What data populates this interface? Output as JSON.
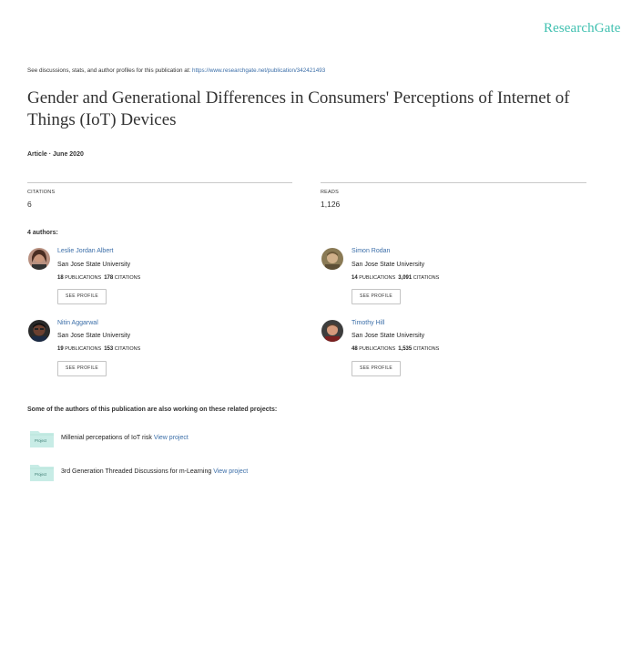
{
  "header": {
    "brand": "ResearchGate",
    "see_line_prefix": "See discussions, stats, and author profiles for this publication at:",
    "see_line_url": "https://www.researchgate.net/publication/342421493"
  },
  "publication": {
    "title": "Gender and Generational Differences in Consumers' Perceptions of Internet of Things (IoT) Devices",
    "meta": "Article · June 2020"
  },
  "stats": {
    "citations_label": "CITATIONS",
    "citations_value": "6",
    "reads_label": "READS",
    "reads_value": "1,126"
  },
  "authors_heading": "4 authors:",
  "authors": [
    {
      "name": "Leslie Jordan Albert",
      "institution": "San Jose State University",
      "publications": "18",
      "publications_label": "PUBLICATIONS",
      "citations": "178",
      "citations_label": "CITATIONS",
      "button": "SEE PROFILE"
    },
    {
      "name": "Simon Rodan",
      "institution": "San Jose State University",
      "publications": "14",
      "publications_label": "PUBLICATIONS",
      "citations": "3,091",
      "citations_label": "CITATIONS",
      "button": "SEE PROFILE"
    },
    {
      "name": "Nitin Aggarwal",
      "institution": "San Jose State University",
      "publications": "19",
      "publications_label": "PUBLICATIONS",
      "citations": "153",
      "citations_label": "CITATIONS",
      "button": "SEE PROFILE"
    },
    {
      "name": "Timothy Hill",
      "institution": "San Jose State University",
      "publications": "48",
      "publications_label": "PUBLICATIONS",
      "citations": "1,535",
      "citations_label": "CITATIONS",
      "button": "SEE PROFILE"
    }
  ],
  "related": {
    "heading": "Some of the authors of this publication are also working on these related projects:",
    "icon_label": "Project",
    "link_label": "View project",
    "projects": [
      {
        "name": "Millenial percepations of IoT risk"
      },
      {
        "name": "3rd Generation Threaded Discussions for m-Learning"
      }
    ]
  },
  "colors": {
    "brand": "#40c0b0",
    "link": "#3b6ea8",
    "project_icon": "#c8ece6"
  }
}
